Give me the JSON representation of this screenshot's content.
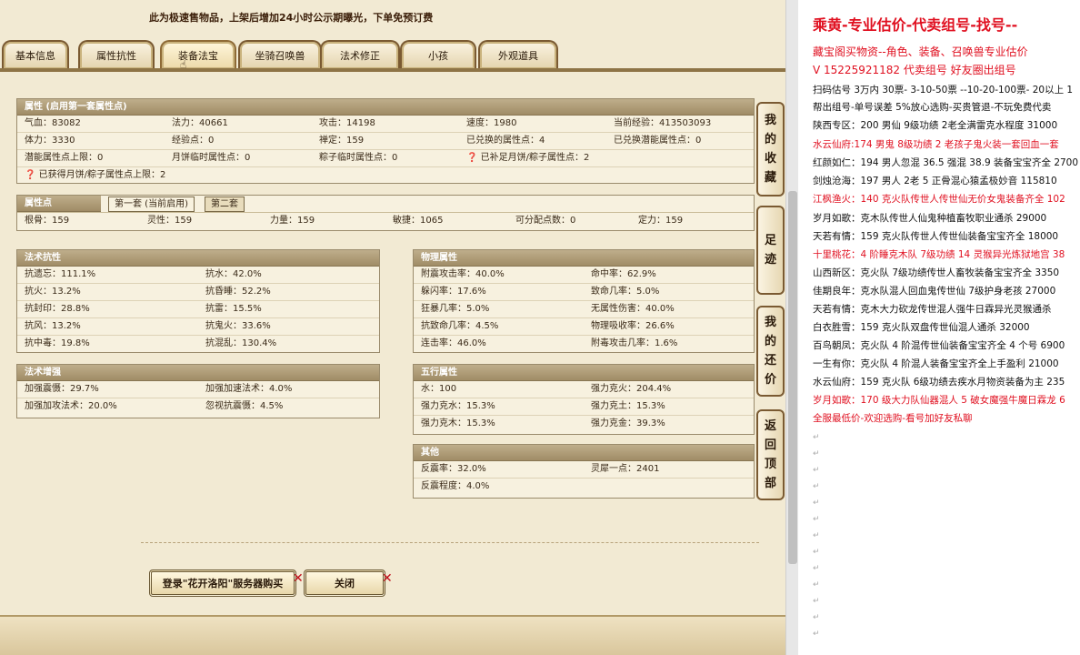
{
  "notice": "此为极速售物品，上架后增加24小时公示期曝光，下单免预订费",
  "tabs": [
    "基本信息",
    "属性抗性",
    "装备法宝",
    "坐骑召唤兽",
    "法术修正",
    "小孩",
    "外观道具"
  ],
  "side_buttons": [
    [
      "我",
      "的",
      "收",
      "藏"
    ],
    [
      "足",
      "迹"
    ],
    [
      "我",
      "的",
      "还",
      "价"
    ],
    [
      "返",
      "回",
      "顶",
      "部"
    ]
  ],
  "attr_panel": {
    "title": "属性 (启用第一套属性点)",
    "rows": [
      [
        "气血：83082",
        "法力：40661",
        "攻击：14198",
        "速度：1980",
        "当前经验：413503093"
      ],
      [
        "体力：3330",
        "经验点：0",
        "禅定：159",
        "已兑换的属性点：4",
        "已兑换潜能属性点：0"
      ],
      [
        "潜能属性点上限：0",
        "月饼临时属性点：0",
        "粽子临时属性点：0",
        "已补足月饼/粽子属性点：2",
        ""
      ],
      [
        "已获得月饼/粽子属性点上限：2",
        "",
        "",
        "",
        ""
      ]
    ]
  },
  "points_panel": {
    "title": "属性点",
    "subtabs": [
      "第一套 (当前启用)",
      "第二套"
    ],
    "values": [
      "根骨：159",
      "灵性：159",
      "力量：159",
      "敏捷：1065",
      "可分配点数：0",
      "定力：159"
    ]
  },
  "magic_resist": {
    "title": "法术抗性",
    "rows": [
      [
        "抗遗忘：111.1%",
        "抗水：42.0%"
      ],
      [
        "抗火：13.2%",
        "抗昏睡：52.2%"
      ],
      [
        "抗封印：28.8%",
        "抗雷：15.5%"
      ],
      [
        "抗风：13.2%",
        "抗鬼火：33.6%"
      ],
      [
        "抗中毒：19.8%",
        "抗混乱：130.4%"
      ]
    ]
  },
  "magic_boost": {
    "title": "法术增强",
    "rows": [
      [
        "加强震慑：29.7%",
        "加强加速法术：4.0%"
      ],
      [
        "加强加攻法术：20.0%",
        "忽视抗震慑：4.5%"
      ]
    ]
  },
  "physical": {
    "title": "物理属性",
    "rows": [
      [
        "附震攻击率：40.0%",
        "命中率：62.9%"
      ],
      [
        "躲闪率：17.6%",
        "致命几率：5.0%"
      ],
      [
        "狂暴几率：5.0%",
        "无属性伤害：40.0%"
      ],
      [
        "抗致命几率：4.5%",
        "物理吸收率：26.6%"
      ],
      [
        "连击率：46.0%",
        "附毒攻击几率：1.6%"
      ]
    ]
  },
  "five_elements": {
    "title": "五行属性",
    "rows": [
      [
        "水：100",
        "强力克火：204.4%"
      ],
      [
        "强力克水：15.3%",
        "强力克土：15.3%"
      ],
      [
        "强力克木：15.3%",
        "强力克金：39.3%"
      ]
    ]
  },
  "other": {
    "title": "其他",
    "rows": [
      [
        "反震率：32.0%",
        "灵犀一点：2401"
      ],
      [
        "反震程度：4.0%",
        ""
      ]
    ]
  },
  "buttons": {
    "login": "登录\"花开洛阳\"服务器购买",
    "close": "关闭"
  },
  "right_panel": {
    "title": "乘黄-专业估价-代卖组号-找号--",
    "lines": [
      {
        "text": "藏宝阁买物资--角色、装备、召唤兽专业估价",
        "color": "#e01020"
      },
      {
        "text": "V 15225921182 代卖组号 好友圈出组号",
        "color": "#e01020"
      },
      {
        "text": "扫码估号 3万内 30票- 3-10-50票 --10-20-100票- 20以上 1",
        "color": "#111"
      },
      {
        "text": "帮出组号-单号误差 5%放心选购-买贵管退-不玩免费代卖",
        "color": "#111"
      },
      {
        "text": "陕西专区：200 男仙 9级功绩 2老全满雷克水程度 31000",
        "color": "#111"
      },
      {
        "text": "水云仙府:174 男鬼 8级功绩 2 老孩子鬼火装一套回血一套",
        "color": "#e01020"
      },
      {
        "text": "红颜如仁：194 男人忽混 36.5 强混 38.9 装备宝宝齐全 2700",
        "color": "#111"
      },
      {
        "text": "剑烛沧海：197 男人 2老 5 正骨混心猿孟极妙音 115810",
        "color": "#111"
      },
      {
        "text": "江枫渔火：140 克火队传世人传世仙无价女鬼装备齐全 102",
        "color": "#e01020"
      },
      {
        "text": "岁月如歌：克木队传世人仙鬼种植畜牧职业通杀 29000",
        "color": "#111"
      },
      {
        "text": "天若有情：159 克火队传世人传世仙装备宝宝齐全 18000",
        "color": "#111"
      },
      {
        "text": "十里桃花：4 阶睡克木队 7级功绩 14 灵猴异光炼狱地宫 38",
        "color": "#e01020"
      },
      {
        "text": "山西新区：克火队 7级功绩传世人畜牧装备宝宝齐全 3350",
        "color": "#111"
      },
      {
        "text": "佳期良年：克水队混人回血鬼传世仙 7级护身老孩 27000",
        "color": "#111"
      },
      {
        "text": "天若有情：克木大力砍龙传世混人强牛日霖异光灵猴通杀",
        "color": "#111"
      },
      {
        "text": "白衣胜雪：159 克火队双盘传世仙混人通杀 32000",
        "color": "#111"
      },
      {
        "text": "百鸟朝凤：克火队 4 阶混传世仙装备宝宝齐全 4 个号 6900",
        "color": "#111"
      },
      {
        "text": "一生有你：克火队 4 阶混人装备宝宝齐全上手盈利 21000",
        "color": "#111"
      },
      {
        "text": "水云仙府：159 克火队 6级功绩去疾水月物资装备为主 235",
        "color": "#111"
      },
      {
        "text": "岁月如歌：170 级大力队仙器混人 5 破女魔强牛魔日霖龙 6",
        "color": "#e01020"
      },
      {
        "text": "全服最低价-欢迎选购-看号加好友私聊",
        "color": "#e01020"
      }
    ]
  }
}
